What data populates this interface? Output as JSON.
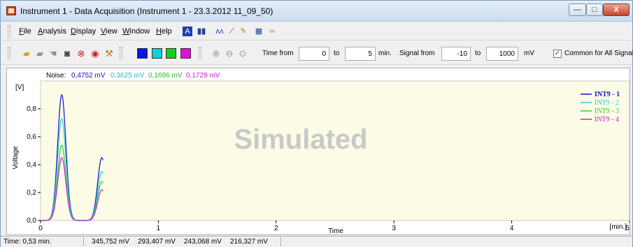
{
  "window": {
    "title": "Instrument 1 - Data Acquisition (Instrument 1 - 23.3.2012 11_09_50)",
    "controls": {
      "minimize": "—",
      "maximize": "□",
      "close": "X"
    }
  },
  "menu": {
    "items": [
      "File",
      "Analysis",
      "Display",
      "View",
      "Window",
      "Help"
    ],
    "icons": [
      "report-icon",
      "bar-chart-icon",
      "peaks-icon",
      "chart-edit-icon",
      "pencil-icon",
      "instrument-icon",
      "link-icon"
    ]
  },
  "toolbar": {
    "icons": [
      "open-icon",
      "method-icon",
      "hand-icon",
      "camera-icon",
      "stop-icon",
      "abort-icon",
      "wrench-icon"
    ],
    "signal_colors": [
      "#1010e0",
      "#10d0e0",
      "#10d020",
      "#e010d0"
    ],
    "zoom_icons": [
      "zoom-in-icon",
      "zoom-out-icon",
      "zoom-reset-icon"
    ],
    "time_from_label": "Time from",
    "time_from": "0",
    "time_to_label": "to",
    "time_to": "5",
    "time_unit": "min.",
    "signal_from_label": "Signal from",
    "signal_from": "-10",
    "signal_to_label": "to",
    "signal_to": "1000",
    "signal_unit": "mV",
    "common_label": "Common for All Signals",
    "common_checked": true
  },
  "chart_data": {
    "type": "line",
    "xlabel": "Time",
    "ylabel": "Voltage",
    "x_unit": "[min.]",
    "y_unit": "[V]",
    "xlim": [
      0,
      5
    ],
    "ylim": [
      0,
      1.0
    ],
    "x_ticks": [
      "0",
      "1",
      "2",
      "3",
      "4",
      "5"
    ],
    "y_ticks": [
      "0,0",
      "0,2",
      "0,4",
      "0,6",
      "0,8"
    ],
    "watermark": "Simulated",
    "noise_label": "Noise:",
    "noise_values": [
      "0,4752 mV",
      "0,3625 mV",
      "0,1686 mV",
      "0,1729 mV"
    ],
    "background": "#fbfbe6",
    "series": [
      {
        "name": "INT9 - 1",
        "color": "#1010c8",
        "peaks": [
          {
            "center": 0.18,
            "height": 0.9,
            "width": 0.035
          },
          {
            "center": 0.52,
            "height": 0.45,
            "width": 0.035
          }
        ]
      },
      {
        "name": "INT9 - 2",
        "color": "#30c8e0",
        "peaks": [
          {
            "center": 0.18,
            "height": 0.73,
            "width": 0.035
          },
          {
            "center": 0.52,
            "height": 0.35,
            "width": 0.035
          }
        ]
      },
      {
        "name": "INT9 - 3",
        "color": "#30d030",
        "peaks": [
          {
            "center": 0.18,
            "height": 0.54,
            "width": 0.035
          },
          {
            "center": 0.52,
            "height": 0.28,
            "width": 0.035
          }
        ]
      },
      {
        "name": "INT9 - 4",
        "color": "#d020d0",
        "peaks": [
          {
            "center": 0.18,
            "height": 0.45,
            "width": 0.035
          },
          {
            "center": 0.52,
            "height": 0.22,
            "width": 0.035
          }
        ]
      }
    ],
    "x_end": 0.53
  },
  "status": {
    "time": "Time: 0,53 min.",
    "values": [
      "345,752 mV",
      "293,407 mV",
      "243,068 mV",
      "216,327 mV"
    ]
  }
}
